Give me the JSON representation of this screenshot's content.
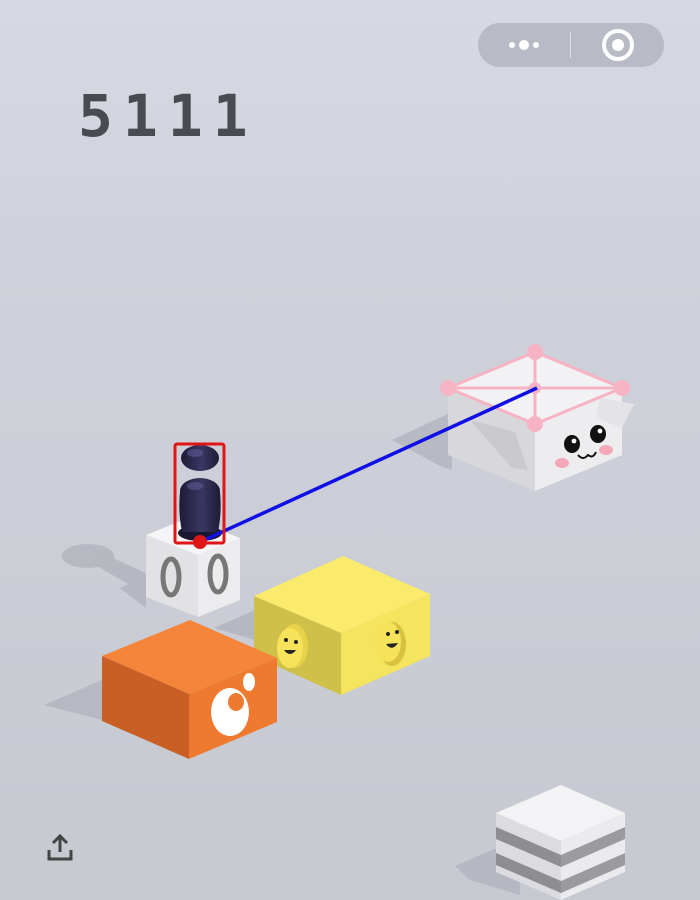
{
  "hud": {
    "score": "5111"
  },
  "capsule": {
    "more_icon": "more-dots-icon",
    "close_icon": "target-circle-icon"
  },
  "share": {
    "icon": "share-upload-icon"
  },
  "colors": {
    "aim_line": "#1010e6",
    "highlight_box": "#e01515",
    "target_marker": "#f4a7b9",
    "orange_block": "#f0833a",
    "yellow_block": "#f7e35a",
    "player": "#2c2a4a"
  }
}
